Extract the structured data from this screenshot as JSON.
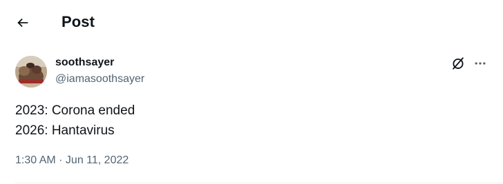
{
  "header": {
    "title": "Post",
    "back_icon": "arrow-left-icon"
  },
  "post": {
    "author": {
      "display_name": "soothsayer",
      "handle": "@iamasoothsayer",
      "avatar": "avatar-image"
    },
    "text_lines": [
      "2023: Corona ended",
      "2026: Hantavirus"
    ],
    "time": "1:30 AM",
    "separator": " · ",
    "date": "Jun 11, 2022",
    "actions": {
      "grok_icon": "grok-icon",
      "more_icon": "more-horizontal-icon"
    }
  },
  "colors": {
    "text_primary": "#0f1419",
    "text_secondary": "#536471",
    "divider": "#eff3f4",
    "background": "#ffffff"
  }
}
